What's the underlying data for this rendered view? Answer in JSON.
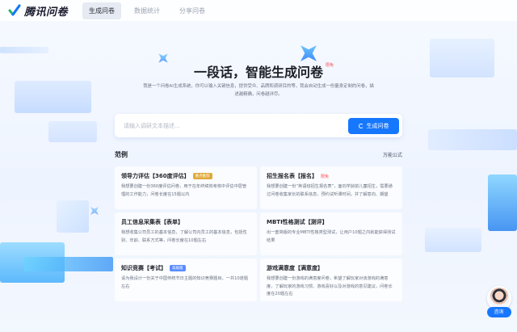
{
  "header": {
    "logo_text": "腾讯问卷",
    "tabs": [
      {
        "label": "生成问卷",
        "active": true
      },
      {
        "label": "数据统计",
        "active": false
      },
      {
        "label": "分享问卷",
        "active": false
      }
    ]
  },
  "hero": {
    "title": "一段话，智能生成问卷",
    "badge": "限免",
    "description": "我是一个问卷AI生成系统，你可以输入关键信息，提供受众、品牌和调研目的等，我会自动生成一份量身定制的问卷，描述越精确，问卷越详尽。"
  },
  "search": {
    "placeholder": "请输入调研文本描述...",
    "value": "",
    "button_label": "生成问卷"
  },
  "examples": {
    "title": "范例",
    "link_label": "万能公式",
    "cards": [
      {
        "title": "领导力评估【360度评估】",
        "tag": "重点推荐",
        "tag_style": "gold",
        "description": "我想要创建一份360度评估问卷，用于在年终绩效考核中评估中层管理的工作能力，问卷长度在15题以内"
      },
      {
        "title": "招生报名表【报名】",
        "tag": "限免",
        "tag_style": "hot",
        "description": "我想要创建一份“英语班招生报名表”，面向学龄前儿童招生，需要通过问卷收集家长的联系信息，预约试听课时间，并了解意向、期望"
      },
      {
        "title": "员工信息采集表【表单】",
        "tag": "",
        "tag_style": "",
        "description": "我想收集公司员工的基本信息，了解公司内员工的基本信息，包括性别、年龄、联系方式等，问卷长度在10题左右"
      },
      {
        "title": "MBTI性格测试【测评】",
        "tag": "",
        "tag_style": "",
        "description": "出一套简版的专业MBTI性格类型测试，让用户10题之内就能获得测试结果"
      },
      {
        "title": "知识竞赛【考试】",
        "tag": "高级版",
        "tag_style": "blue",
        "description": "请为我设计一份关于中国传统节日主题的知识竞赛题目，一共10道题左右"
      },
      {
        "title": "游戏满意度【满意度】",
        "tag": "",
        "tag_style": "",
        "description": "我想要创建一份游戏的满意度问卷，希望了解玩家对该游戏的满意度，了解玩家的游戏习惯、游戏喜好以及对游戏的意见建议，问卷长度在20题左右"
      }
    ]
  },
  "consult": {
    "label": "咨询"
  },
  "colors": {
    "accent": "#1677ff",
    "hot": "#ff4d4f",
    "gold_tag": "#e0a93b",
    "blue_tag": "#5a8cff"
  }
}
